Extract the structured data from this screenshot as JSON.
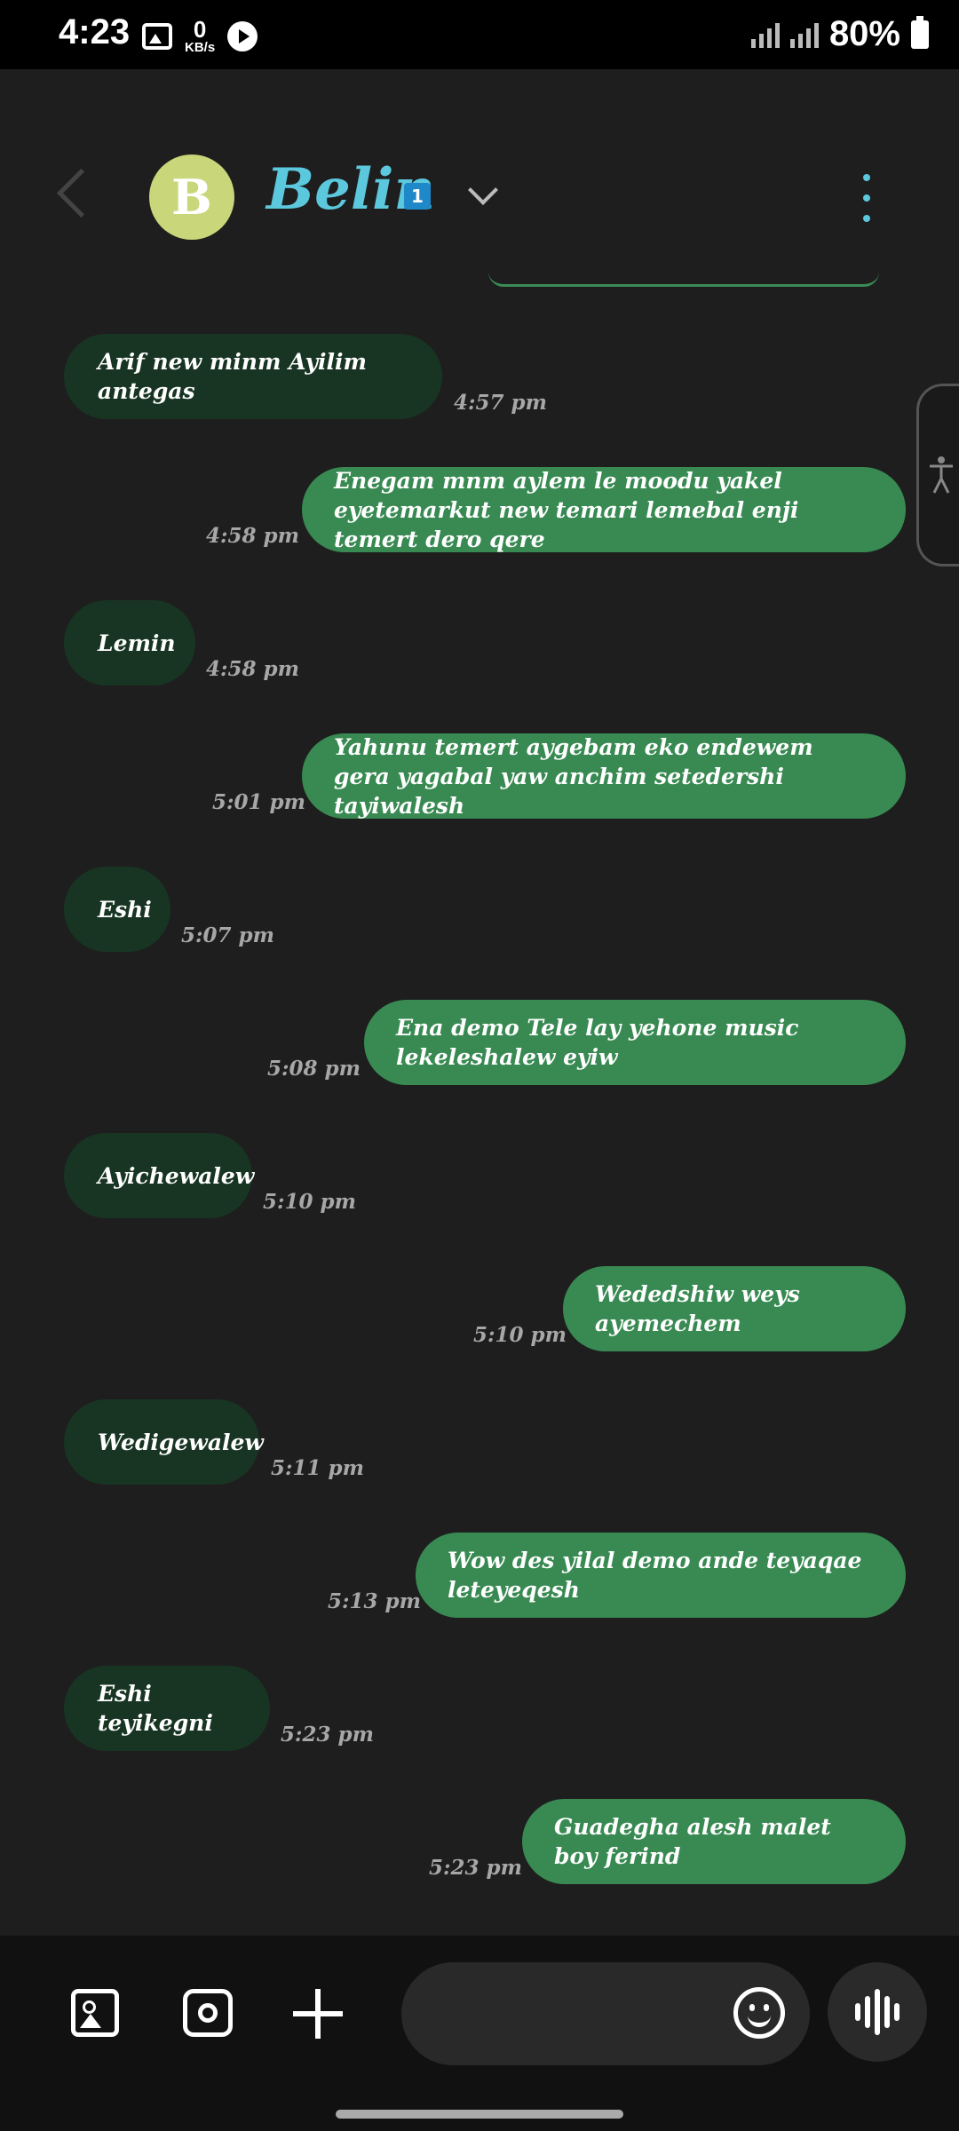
{
  "status_bar": {
    "time": "4:23",
    "net_speed_value": "0",
    "net_speed_unit": "KB/s",
    "battery": "80%"
  },
  "header": {
    "avatar_letter": "B",
    "contact_name": "Belin",
    "sim_badge": "1"
  },
  "colors": {
    "incoming_bubble": "#183523",
    "outgoing_bubble": "#388a52",
    "name_accent": "#5bc8dd",
    "avatar_bg": "#c9d679"
  },
  "messages": [
    {
      "direction": "in",
      "text": "Arif new minm Ayilim antegas",
      "time": "4:57 pm"
    },
    {
      "direction": "out",
      "text": "Enegam mnm aylem le moodu yakel eyetemarkut new temari lemebal enji temert dero qere",
      "time": "4:58 pm"
    },
    {
      "direction": "in",
      "text": "Lemin",
      "time": "4:58 pm"
    },
    {
      "direction": "out",
      "text": "Yahunu temert aygebam eko endewem gera yagabal yaw anchim setedershi tayiwalesh",
      "time": "5:01 pm"
    },
    {
      "direction": "in",
      "text": "Eshi",
      "time": "5:07 pm"
    },
    {
      "direction": "out",
      "text": "Ena demo Tele lay yehone music lekeleshalew eyiw",
      "time": "5:08 pm"
    },
    {
      "direction": "in",
      "text": "Ayichewalew",
      "time": "5:10 pm"
    },
    {
      "direction": "out",
      "text": "Wededshiw weys ayemechem",
      "time": "5:10 pm"
    },
    {
      "direction": "in",
      "text": "Wedigewalew",
      "time": "5:11 pm"
    },
    {
      "direction": "out",
      "text": "Wow des yilal demo ande teyaqae leteyeqesh",
      "time": "5:13 pm"
    },
    {
      "direction": "in",
      "text": "Eshi teyikegni",
      "time": "5:23 pm"
    },
    {
      "direction": "out",
      "text": "Guadegha alesh malet boy ferind",
      "time": "5:23 pm"
    }
  ],
  "composer": {
    "input_value": "",
    "input_placeholder": ""
  }
}
